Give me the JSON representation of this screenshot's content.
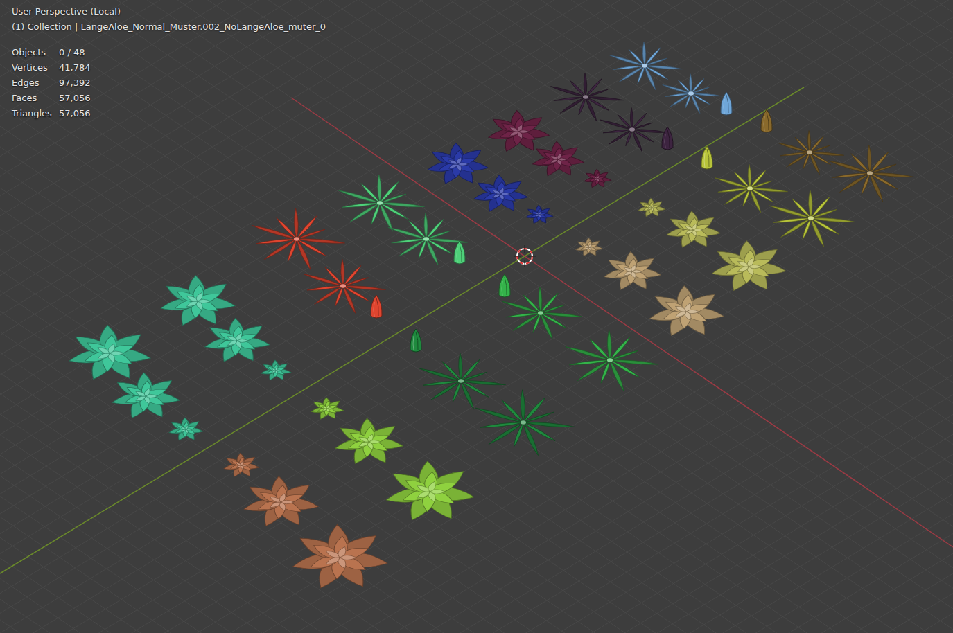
{
  "viewport": {
    "header": "User Perspective (Local)",
    "collection": "(1) Collection | LangeAloe_Normal_Muster.002_NoLangeAloe_muter_0"
  },
  "stats": [
    {
      "label": "Objects",
      "value": "0 / 48"
    },
    {
      "label": "Vertices",
      "value": "41,784"
    },
    {
      "label": "Edges",
      "value": "97,392"
    },
    {
      "label": "Faces",
      "value": "57,056"
    },
    {
      "label": "Triangles",
      "value": "57,056"
    }
  ],
  "plants": [
    {
      "kind": "rosette",
      "color": "#3fc79a"
    },
    {
      "kind": "rosette",
      "color": "#3fc79a"
    },
    {
      "kind": "rosette",
      "color": "#3fc79a"
    },
    {
      "kind": "rosette",
      "color": "#3fc79a"
    },
    {
      "kind": "rosette",
      "color": "#3fc79a"
    },
    {
      "kind": "rosette",
      "color": "#3fc79a"
    },
    {
      "kind": "rosette",
      "color": "#8fd13f"
    },
    {
      "kind": "rosette",
      "color": "#8fd13f"
    },
    {
      "kind": "rosette",
      "color": "#8fd13f"
    },
    {
      "kind": "rosette",
      "color": "#b9734f"
    },
    {
      "kind": "rosette",
      "color": "#b9734f"
    },
    {
      "kind": "rosette",
      "color": "#b9734f"
    },
    {
      "kind": "spiky",
      "color": "#e0452f"
    },
    {
      "kind": "spiky",
      "color": "#e0452f"
    },
    {
      "kind": "bud",
      "color": "#e0452f"
    },
    {
      "kind": "spiky",
      "color": "#4fd17a"
    },
    {
      "kind": "spiky",
      "color": "#4fd17a"
    },
    {
      "kind": "bud",
      "color": "#4fd17a"
    },
    {
      "kind": "rosette",
      "color": "#2a3aa8"
    },
    {
      "kind": "rosette",
      "color": "#2a3aa8"
    },
    {
      "kind": "rosette",
      "color": "#2a3aa8"
    },
    {
      "kind": "rosette",
      "color": "#6e2347"
    },
    {
      "kind": "rosette",
      "color": "#6e2347"
    },
    {
      "kind": "rosette",
      "color": "#6e2347"
    },
    {
      "kind": "spiky",
      "color": "#3d2440"
    },
    {
      "kind": "spiky",
      "color": "#3d2440"
    },
    {
      "kind": "bud",
      "color": "#3d2440"
    },
    {
      "kind": "spiky",
      "color": "#6fa6d8"
    },
    {
      "kind": "spiky",
      "color": "#6fa6d8"
    },
    {
      "kind": "bud",
      "color": "#6fa6d8"
    },
    {
      "kind": "spiky",
      "color": "#8a6a2c"
    },
    {
      "kind": "spiky",
      "color": "#8a6a2c"
    },
    {
      "kind": "bud",
      "color": "#8a6a2c"
    },
    {
      "kind": "spiky",
      "color": "#b8c43a"
    },
    {
      "kind": "spiky",
      "color": "#b8c43a"
    },
    {
      "kind": "bud",
      "color": "#b8c43a"
    },
    {
      "kind": "rosette",
      "color": "#b9bb5a"
    },
    {
      "kind": "rosette",
      "color": "#b9bb5a"
    },
    {
      "kind": "rosette",
      "color": "#b9bb5a"
    },
    {
      "kind": "rosette",
      "color": "#bfa274"
    },
    {
      "kind": "rosette",
      "color": "#bfa274"
    },
    {
      "kind": "rosette",
      "color": "#bfa274"
    },
    {
      "kind": "spiky",
      "color": "#34b34a"
    },
    {
      "kind": "spiky",
      "color": "#34b34a"
    },
    {
      "kind": "bud",
      "color": "#34b34a"
    },
    {
      "kind": "spiky",
      "color": "#1f8a3e"
    },
    {
      "kind": "spiky",
      "color": "#1f8a3e"
    },
    {
      "kind": "bud",
      "color": "#1f8a3e"
    }
  ]
}
